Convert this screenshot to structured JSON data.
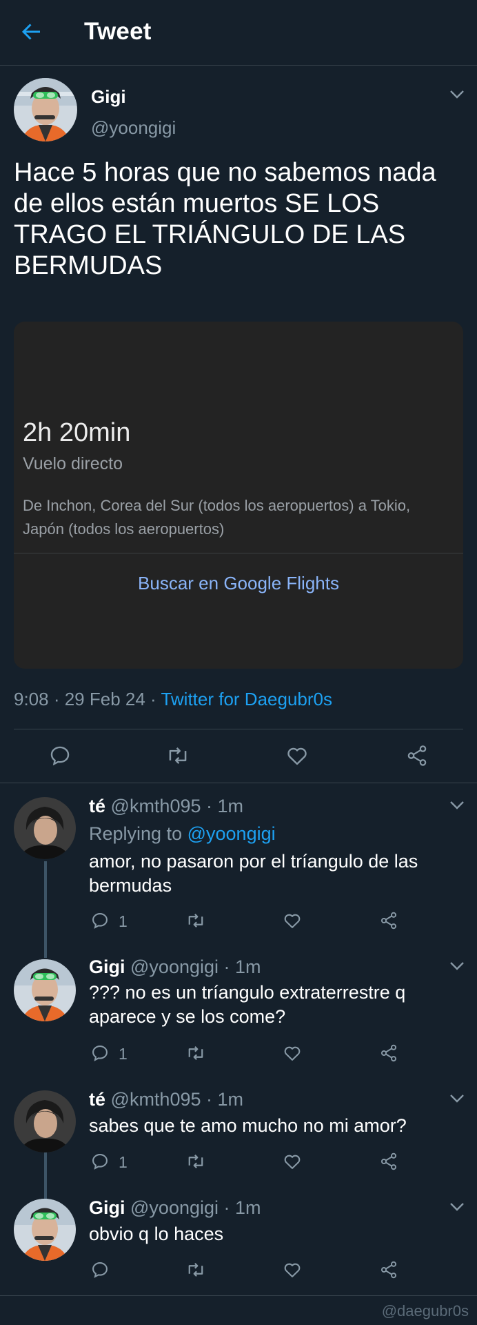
{
  "header": {
    "title": "Tweet"
  },
  "tweet": {
    "name": "Gigi",
    "handle": "@yoongigi",
    "text": "Hace 5 horas que no sabemos nada de ellos están muertos SE LOS TRAGO EL TRIÁNGULO DE LAS BERMUDAS",
    "card": {
      "duration": "2h 20min",
      "type": "Vuelo directo",
      "route": "De Inchon, Corea del Sur (todos los aeropuertos) a Tokio, Japón (todos los aeropuertos)",
      "link": "Buscar en Google Flights"
    },
    "meta": {
      "time": "9:08 · 29 Feb 24 · ",
      "source": "Twitter for Daegubr0s"
    }
  },
  "replies": [
    {
      "name": "té",
      "handle": "@kmth095",
      "time": "· 1m",
      "replying_label": "Replying to",
      "replying_to": "@yoongigi",
      "text": "amor, no pasaron por el tríangulo de las bermudas",
      "reply_count": "1"
    },
    {
      "name": "Gigi",
      "handle": "@yoongigi",
      "time": "· 1m",
      "text": "??? no es un tríangulo extraterrestre q aparece y se los come?",
      "reply_count": "1"
    },
    {
      "name": "té",
      "handle": "@kmth095",
      "time": "· 1m",
      "text": "sabes que te amo mucho no mi amor?",
      "reply_count": "1"
    },
    {
      "name": "Gigi",
      "handle": "@yoongigi",
      "time": "· 1m",
      "text": "obvio q lo haces",
      "reply_count": ""
    }
  ],
  "watermark": "@daegubr0s",
  "colors": {
    "background": "#15202b",
    "accent": "#1da1f2",
    "secondary_text": "#8899a6",
    "card_background": "#232323",
    "card_link": "#8ab4f8"
  },
  "icons": [
    "back-arrow-icon",
    "chevron-down-icon",
    "reply-icon",
    "retweet-icon",
    "like-icon",
    "share-icon"
  ]
}
